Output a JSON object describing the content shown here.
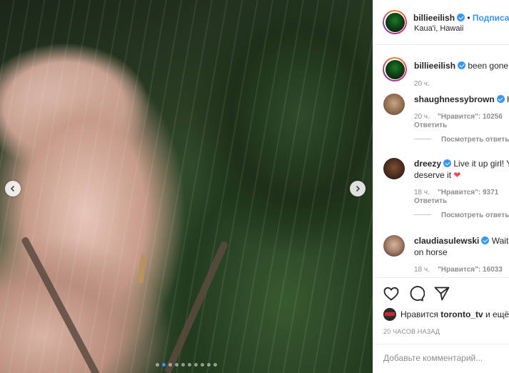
{
  "post": {
    "username": "billieeilish",
    "follow_label": "Подписаться",
    "location": "Kaua'i, Hawaii",
    "caption_text": "been gone",
    "caption_time": "20 ч.",
    "carousel_dots": 10,
    "active_dot": 1
  },
  "comments": [
    {
      "username": "shaughnessybrown",
      "text": "H",
      "time": "20 ч.",
      "likes": "\"Нравится\": 10256",
      "reply_label": "Ответить",
      "view_replies": "Посмотреть ответы"
    },
    {
      "username": "dreezy",
      "text": "Live it up girl! Y",
      "text_line2": "deserve it",
      "time": "18 ч.",
      "likes": "\"Нравится\": 9371",
      "reply_label": "Ответить",
      "view_replies": "Посмотреть ответы"
    },
    {
      "username": "claudiasulewski",
      "text": "Waitin",
      "text_line2": "on horse",
      "time": "18 ч.",
      "likes": "\"Нравится\": 16033"
    }
  ],
  "actions": {
    "likes_prefix": "Нравится",
    "likes_user": "toronto_tv",
    "likes_suffix": "и ещё",
    "time_ago": "20 ЧАСОВ НАЗАД",
    "add_comment_placeholder": "Добавьте комментарий..."
  },
  "icons": {
    "like": "heart-icon",
    "comment": "comment-icon",
    "share": "share-icon",
    "verified": "verified-badge-icon",
    "prev": "chevron-left-icon",
    "next": "chevron-right-icon"
  },
  "colors": {
    "accent": "#3897f0",
    "text": "#262626",
    "muted": "#8e8e8e",
    "heart": "#ed4956"
  }
}
